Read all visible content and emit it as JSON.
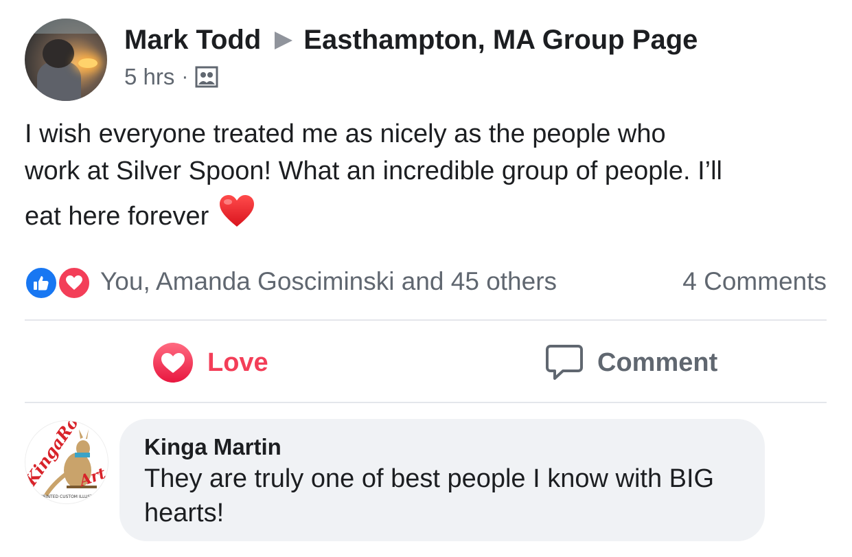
{
  "post": {
    "author": "Mark Todd",
    "group": "Easthampton, MA Group Page",
    "time": "5 hrs",
    "separator": "·",
    "text_line1": "I wish everyone treated me as nicely as the people who",
    "text_line2": "work at Silver Spoon! What an incredible group of people. I’ll",
    "text_line3": "eat here forever"
  },
  "reactions": {
    "summary": "You, Amanda Gosciminski and 45 others",
    "comments_count": "4 Comments",
    "icons": [
      "like-icon",
      "love-icon"
    ]
  },
  "actions": {
    "love_label": "Love",
    "comment_label": "Comment"
  },
  "comment": {
    "author": "Kinga Martin",
    "text": "They are truly one of best people I know with BIG hearts!",
    "avatar_logo_text": "KingaRoo Art",
    "avatar_logo_subtext": "PRINTED CUSTOM ILLUSTRATIONS"
  },
  "colors": {
    "love": "#f33e58",
    "like": "#1877f2",
    "secondary_text": "#606770",
    "bubble": "#f0f2f5"
  }
}
